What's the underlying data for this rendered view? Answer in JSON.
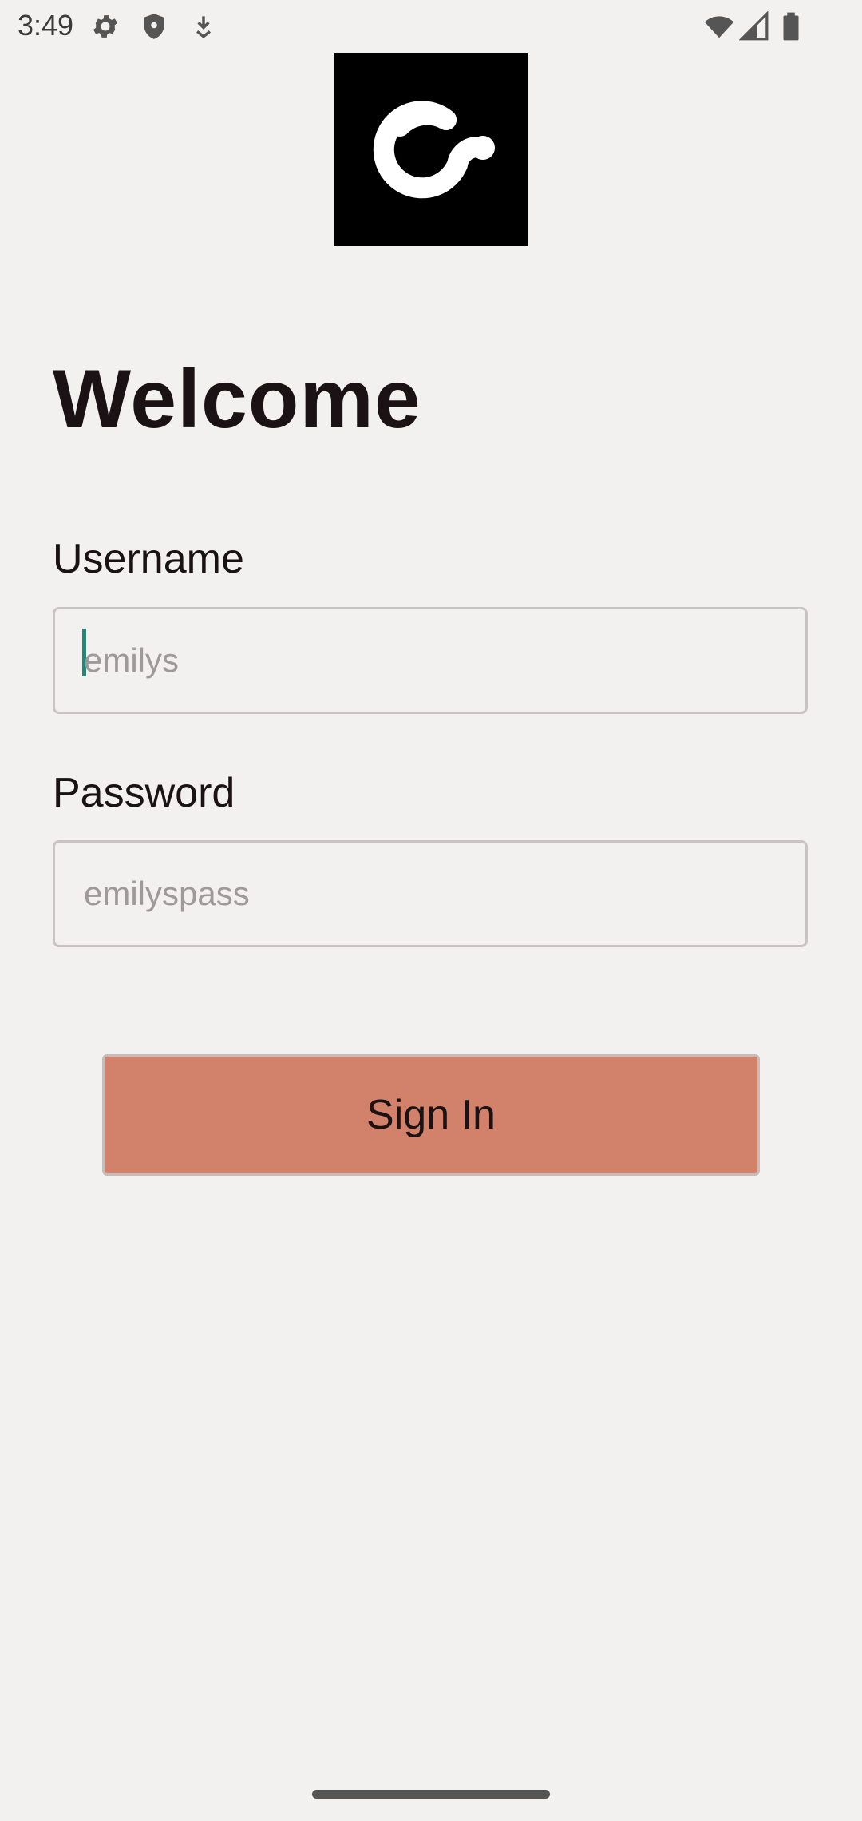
{
  "status_bar": {
    "time": "3:49",
    "icons": [
      "gear-icon",
      "shield-icon",
      "download-icon",
      "wifi-icon",
      "signal-icon",
      "battery-icon"
    ]
  },
  "logo": {
    "icon": "brand-logo-icon",
    "background": "#000000",
    "foreground": "#ffffff"
  },
  "title": "Welcome",
  "form": {
    "username": {
      "label": "Username",
      "value": "",
      "placeholder": "emilys"
    },
    "password": {
      "label": "Password",
      "value": "",
      "placeholder": "emilyspass"
    },
    "submit_label": "Sign In"
  },
  "colors": {
    "background": "#f3f1f0",
    "accent_button": "#d2826a",
    "caret": "#1a8c7c"
  }
}
